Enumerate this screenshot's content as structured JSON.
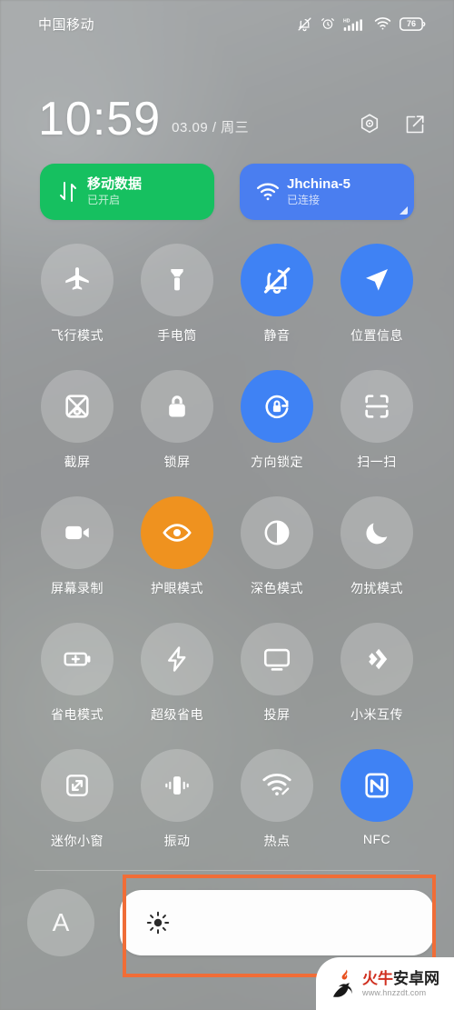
{
  "status_bar": {
    "carrier": "中国移动",
    "battery_level": "76",
    "icons": [
      "bell-mute-icon",
      "alarm-clock-icon",
      "hd-signal-icon",
      "wifi-icon",
      "battery-icon"
    ]
  },
  "clock": {
    "time": "10:59",
    "date": "03.09 / 周三",
    "actions": [
      "settings-gear-icon",
      "edit-icon"
    ]
  },
  "connectivity": [
    {
      "icon": "mobile-data-icon",
      "title": "移动数据",
      "subtitle": "已开启",
      "color": "#16c060",
      "expandable": false
    },
    {
      "icon": "wifi-icon",
      "title": "Jhchina-5",
      "subtitle": "已连接",
      "color": "#4a7ef0",
      "expandable": true
    }
  ],
  "toggles": [
    [
      {
        "icon": "airplane-icon",
        "label": "飞行模式",
        "state": "off"
      },
      {
        "icon": "flashlight-icon",
        "label": "手电筒",
        "state": "off"
      },
      {
        "icon": "bell-mute-icon",
        "label": "静音",
        "state": "on-blue"
      },
      {
        "icon": "location-icon",
        "label": "位置信息",
        "state": "on-blue"
      }
    ],
    [
      {
        "icon": "screenshot-icon",
        "label": "截屏",
        "state": "off"
      },
      {
        "icon": "lock-icon",
        "label": "锁屏",
        "state": "off"
      },
      {
        "icon": "rotation-lock-icon",
        "label": "方向锁定",
        "state": "on-blue"
      },
      {
        "icon": "scan-icon",
        "label": "扫一扫",
        "state": "off"
      }
    ],
    [
      {
        "icon": "video-record-icon",
        "label": "屏幕录制",
        "state": "off"
      },
      {
        "icon": "eye-icon",
        "label": "护眼模式",
        "state": "on-orange"
      },
      {
        "icon": "contrast-icon",
        "label": "深色模式",
        "state": "off"
      },
      {
        "icon": "moon-icon",
        "label": "勿扰模式",
        "state": "off"
      }
    ],
    [
      {
        "icon": "battery-saver-icon",
        "label": "省电模式",
        "state": "off"
      },
      {
        "icon": "bolt-icon",
        "label": "超级省电",
        "state": "off"
      },
      {
        "icon": "cast-screen-icon",
        "label": "投屏",
        "state": "off"
      },
      {
        "icon": "mi-share-icon",
        "label": "小米互传",
        "state": "off"
      }
    ],
    [
      {
        "icon": "mini-window-icon",
        "label": "迷你小窗",
        "state": "off"
      },
      {
        "icon": "vibrate-icon",
        "label": "振动",
        "state": "off"
      },
      {
        "icon": "hotspot-icon",
        "label": "热点",
        "state": "off"
      },
      {
        "icon": "nfc-icon",
        "label": "NFC",
        "state": "on-blue"
      }
    ]
  ],
  "brightness": {
    "auto_label": "A",
    "slider_icon": "sun-icon",
    "fill_percent": 100
  },
  "annotation": {
    "highlight_color": "#f06d37",
    "target": "brightness-slider"
  },
  "watermark": {
    "name_red": "火牛",
    "name_dark": "安卓网",
    "url": "www.hnzzdt.com"
  },
  "colors": {
    "accent_blue": "#3f82f4",
    "accent_orange": "#ef921f",
    "data_green": "#16c060",
    "wifi_blue": "#4a7ef0",
    "highlight": "#f06d37"
  }
}
